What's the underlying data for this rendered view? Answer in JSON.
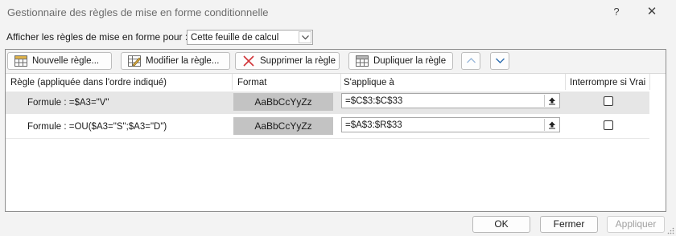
{
  "window": {
    "title": "Gestionnaire des règles de mise en forme conditionnelle",
    "help": "?",
    "close": "✕"
  },
  "show_rules": {
    "label": "Afficher les règles de mise en forme pour :",
    "selected": "Cette feuille de calcul"
  },
  "toolbar": {
    "new_rule": "Nouvelle règle...",
    "edit_rule": "Modifier la règle...",
    "delete_rule": "Supprimer la règle",
    "duplicate_rule": "Dupliquer la règle"
  },
  "columns": {
    "rule": "Règle (appliquée dans l'ordre indiqué)",
    "format": "Format",
    "applies_to": "S'applique à",
    "stop_if_true": "Interrompre si Vrai"
  },
  "rules": [
    {
      "rule": "Formule : =$A3=\"V\"",
      "format_preview": "AaBbCcYyZz",
      "applies_to": "=$C$3:$C$33",
      "stop_if_true": false,
      "selected": true
    },
    {
      "rule": "Formule : =OU($A3=\"S\";$A3=\"D\")",
      "format_preview": "AaBbCcYyZz",
      "applies_to": "=$A$3:$R$33",
      "stop_if_true": false,
      "selected": false
    }
  ],
  "buttons": {
    "ok": "OK",
    "cancel": "Fermer",
    "apply": "Appliquer"
  },
  "colors": {
    "delete_icon": "#d13438",
    "arrow_icon": "#2b6cb0",
    "format_preview_bg": "#c3c3c3",
    "selected_row_bg": "#e6e6e6"
  }
}
